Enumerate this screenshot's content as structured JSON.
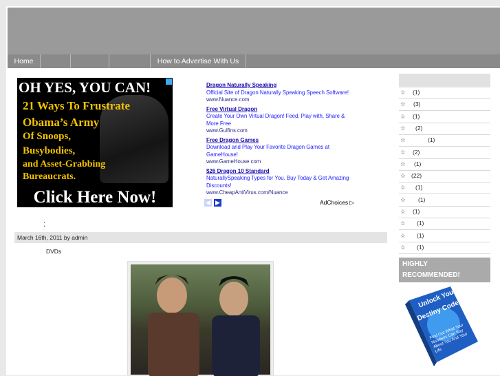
{
  "nav": {
    "items": [
      "Home",
      "",
      "",
      "",
      "How to Advertise With Us"
    ]
  },
  "banner": {
    "lines": [
      "OH YES, YOU CAN!",
      "21 Ways To Frustrate",
      "Obama’s Army",
      "Of Snoops,",
      "Busybodies,",
      "and Asset-Grabbing",
      "Bureaucrats."
    ],
    "cta": "Click Here Now!"
  },
  "ads": [
    {
      "title": "Dragon Naturally Speaking",
      "text": "Official Site of Dragon Naturally Speaking Speech Software!",
      "url": "www.Nuance.com"
    },
    {
      "title": "Free Virtual Dragon",
      "text": "Create Your Own Virtual Dragon! Feed, Play with, Share & More Free",
      "url": "www.Gulfins.com"
    },
    {
      "title": "Free Dragon Games",
      "text": "Download and Play Your Favorite Dragon Games at GameHouse!",
      "url": "www.GameHouse.com"
    },
    {
      "title": "$26 Dragon 10 Standard",
      "text": "NaturallySpeaking Types for You. Buy Today & Get Amazing Discounts!",
      "url": "www.CheapAntiVirus.com/Nuance"
    }
  ],
  "adchoices": "AdChoices",
  "post": {
    "colon": ":",
    "dateline": "March 16th, 2011 by admin",
    "body": "DVDs"
  },
  "sidebar": {
    "categories": [
      {
        "star": "☆",
        "count": "(1)"
      },
      {
        "star": "☆",
        "count": "(3)"
      },
      {
        "star": "☆",
        "count": "(1)"
      },
      {
        "star": "☆",
        "count": "(2)"
      },
      {
        "star": "☆",
        "count": "(1)"
      },
      {
        "star": "☆",
        "count": "(2)"
      },
      {
        "star": "☆",
        "count": "(1)"
      },
      {
        "star": "☆",
        "count": "(22)"
      },
      {
        "star": "☆",
        "count": "(1)"
      },
      {
        "star": "☆",
        "count": "(1)"
      },
      {
        "star": "☆",
        "count": "(1)"
      },
      {
        "star": "☆",
        "count": "(1)"
      },
      {
        "star": "☆",
        "count": "(1)"
      },
      {
        "star": "☆",
        "count": "(1)"
      }
    ],
    "recommended": "HIGHLY RECOMMENDED!",
    "book_title_lines": [
      "Unlock Your",
      "Destiny Code"
    ],
    "book_sub": "Find Out What Your Numbers Can Say About You And Your Life"
  }
}
